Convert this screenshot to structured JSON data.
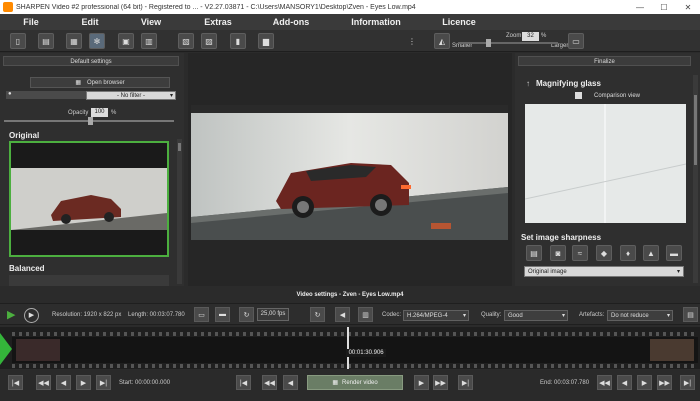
{
  "window": {
    "title": "SHARPEN Video #2 professional (64 bit) - Registered to ... - V2.27.03871 - C:\\Users\\MANSORY1\\Desktop\\Zven - Eyes Low.mp4",
    "minimize": "—",
    "maximize": "☐",
    "close": "✕"
  },
  "menu": [
    "File",
    "Edit",
    "View",
    "Extras",
    "Add-ons",
    "Information",
    "Licence"
  ],
  "toolbar": {
    "zoom_label": "Zoom",
    "zoom_value": "32",
    "zoom_unit": "%",
    "smaller": "Smaller",
    "larger": "Larger",
    "zoom_fraction": 0.3
  },
  "left_panel": {
    "header": "Default settings",
    "open_browser": "Open browser",
    "filter_value": "- No filter -",
    "opacity_label": "Opacity",
    "opacity_value": "100",
    "opacity_unit": "%",
    "original_title": "Original",
    "balanced_title": "Balanced"
  },
  "right_panel": {
    "header": "Finalize",
    "magnifying_title": "Magnifying glass",
    "comparison_view": "Comparison view",
    "sharpness_title": "Set image sharpness",
    "sharpness_select": "Original image"
  },
  "video_settings": {
    "title": "Video settings - Zven - Eyes Low.mp4",
    "resolution": "Resolution: 1920 x 822 px",
    "length": "Length: 00:03:07.780",
    "fps": "25,00 fps",
    "codec_label": "Codec:",
    "codec_value": "H.264/MPEG-4",
    "quality_label": "Quality:",
    "quality_value": "Good",
    "artefacts_label": "Artefacts:",
    "artefacts_value": "Do not reduce"
  },
  "timeline": {
    "marker": "00:01:30.906",
    "marker_fraction": 0.49
  },
  "bottom": {
    "start": "Start: 00:00:00.000",
    "end": "End: 00:03:07.780",
    "render": "Render video"
  }
}
